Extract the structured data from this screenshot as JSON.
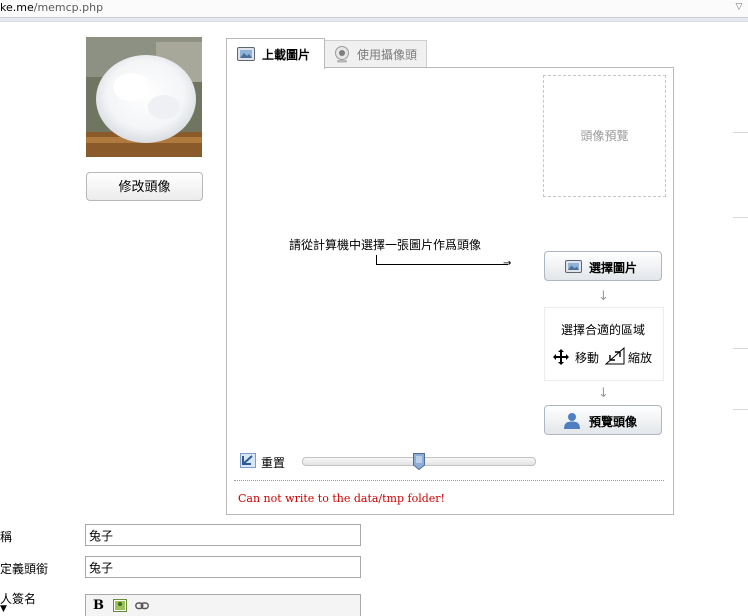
{
  "address_bar": {
    "url_prefix": "ke.me",
    "url_path": "/memcp.php"
  },
  "avatar": {
    "change_button_label": "修改頭像"
  },
  "tabs": [
    {
      "label": "上載圖片",
      "icon": "image-icon",
      "active": true
    },
    {
      "label": "使用攝像頭",
      "icon": "webcam-icon",
      "active": false
    }
  ],
  "panel": {
    "preview_placeholder": "頭像預覽",
    "instruction": "請從計算機中選擇一張圖片作爲頭像",
    "select_image_label": "選擇圖片",
    "crop_title": "選擇合適的區域",
    "move_label": "移動",
    "zoom_label": "縮放",
    "preview_avatar_label": "預覽頭像",
    "reset_label": "重置",
    "zoom_slider_value": 0.5,
    "error_message": "Can not write to the data/tmp folder!"
  },
  "form": {
    "nickname": {
      "label": "稱",
      "value": "兔子"
    },
    "custom_title": {
      "label": "定義頭銜",
      "value": "兔子"
    },
    "signature": {
      "label": "人簽名"
    }
  },
  "colors": {
    "error": "#cc0000",
    "placeholder": "#9a9a9a",
    "border": "#b9b9b9"
  }
}
